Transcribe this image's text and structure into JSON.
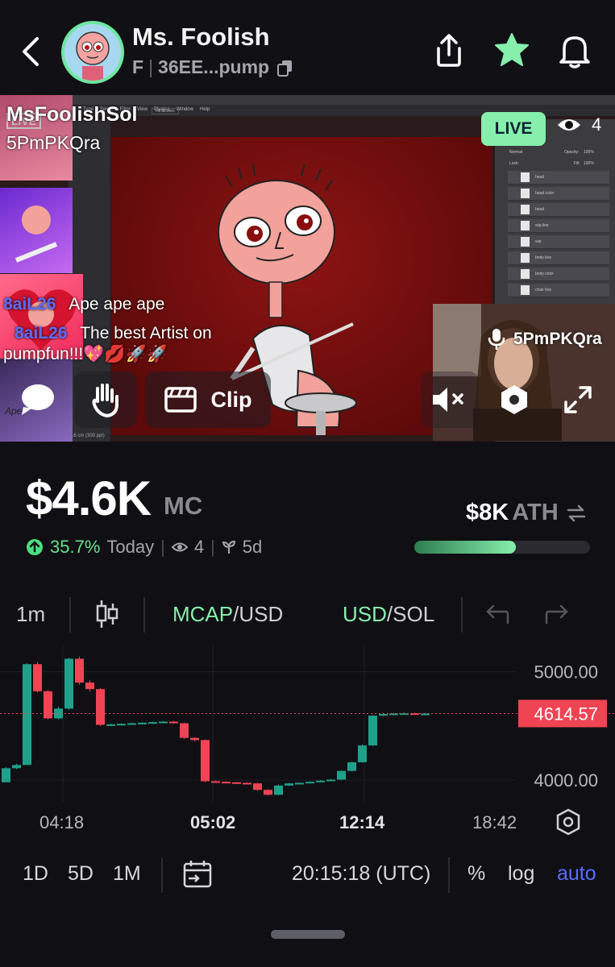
{
  "header": {
    "title": "Ms. Foolish",
    "ticker": "F",
    "contract": "36EE...pump"
  },
  "stream": {
    "streamer_name": "MsFoolishSol",
    "streamer_address": "5PmPKQra",
    "live_label": "LIVE",
    "viewer_count": "4",
    "chat": [
      {
        "user": "8aiL26",
        "text": "Ape ape ape"
      },
      {
        "user": "8aiL26",
        "text": "The best Artist on"
      },
      {
        "user": "",
        "text": "pumpfun!!!💖💋🚀🚀"
      }
    ],
    "webcam_label": "5PmPKQra",
    "clip_label": "Clip",
    "thumbnail_stamp": "LIVE",
    "thumbnail_tag": "Ape",
    "ps_layers": [
      "head",
      "head color",
      "head",
      "wip line",
      "wip",
      "body line",
      "body color",
      "chair line"
    ],
    "ps_panel": {
      "mode": "Normal",
      "opacity_label": "Opacity:",
      "opacity": "100%",
      "lock_label": "Lock:",
      "fill_label": "Fill:",
      "fill": "100%"
    },
    "ps_menu": [
      "Type",
      "Select",
      "Filter",
      "View",
      "Plugins",
      "Window",
      "Help"
    ],
    "ps_button": "Fill Screen",
    "ps_status": "16 cm (300 ppi)"
  },
  "market": {
    "mc_value": "$4.6K",
    "mc_suffix": "MC",
    "change_pct": "35.7%",
    "change_label": "Today",
    "holders": "4",
    "age": "5d",
    "ath_value": "$8K",
    "ath_label": "ATH",
    "ath_progress": 0.58
  },
  "chart_toolbar": {
    "interval": "1m",
    "mcap_left": "MCAP",
    "mcap_right": "/USD",
    "usd_left": "USD",
    "usd_right": "/SOL"
  },
  "chart_data": {
    "type": "candlestick",
    "y_ticks": [
      "5000.00",
      "4000.00"
    ],
    "current_price": "4614.57",
    "x_ticks": [
      "04:18",
      "05:02",
      "12:14",
      "18:42"
    ],
    "ylim": [
      3800,
      5250
    ],
    "candles": [
      {
        "o": 3980,
        "h": 4120,
        "l": 3980,
        "c": 4110
      },
      {
        "o": 4110,
        "h": 4150,
        "l": 4100,
        "c": 4140
      },
      {
        "o": 4140,
        "h": 5080,
        "l": 4140,
        "c": 5070
      },
      {
        "o": 5070,
        "h": 5090,
        "l": 4810,
        "c": 4820
      },
      {
        "o": 4820,
        "h": 4830,
        "l": 4560,
        "c": 4570
      },
      {
        "o": 4570,
        "h": 4680,
        "l": 4560,
        "c": 4660
      },
      {
        "o": 4660,
        "h": 5130,
        "l": 4650,
        "c": 5120
      },
      {
        "o": 5120,
        "h": 5140,
        "l": 4880,
        "c": 4900
      },
      {
        "o": 4900,
        "h": 4920,
        "l": 4820,
        "c": 4840
      },
      {
        "o": 4840,
        "h": 4850,
        "l": 4500,
        "c": 4510
      },
      {
        "o": 4510,
        "h": 4520,
        "l": 4500,
        "c": 4515
      },
      {
        "o": 4515,
        "h": 4525,
        "l": 4505,
        "c": 4520
      },
      {
        "o": 4520,
        "h": 4530,
        "l": 4510,
        "c": 4525
      },
      {
        "o": 4525,
        "h": 4535,
        "l": 4515,
        "c": 4530
      },
      {
        "o": 4530,
        "h": 4540,
        "l": 4520,
        "c": 4535
      },
      {
        "o": 4535,
        "h": 4545,
        "l": 4525,
        "c": 4540
      },
      {
        "o": 4540,
        "h": 4545,
        "l": 4520,
        "c": 4525
      },
      {
        "o": 4525,
        "h": 4530,
        "l": 4380,
        "c": 4390
      },
      {
        "o": 4390,
        "h": 4395,
        "l": 4360,
        "c": 4370
      },
      {
        "o": 4370,
        "h": 4375,
        "l": 3980,
        "c": 3990
      },
      {
        "o": 3990,
        "h": 3995,
        "l": 3980,
        "c": 3985
      },
      {
        "o": 3985,
        "h": 3990,
        "l": 3975,
        "c": 3980
      },
      {
        "o": 3980,
        "h": 3985,
        "l": 3970,
        "c": 3975
      },
      {
        "o": 3975,
        "h": 3980,
        "l": 3965,
        "c": 3970
      },
      {
        "o": 3970,
        "h": 3975,
        "l": 3900,
        "c": 3910
      },
      {
        "o": 3910,
        "h": 3915,
        "l": 3860,
        "c": 3865
      },
      {
        "o": 3865,
        "h": 3960,
        "l": 3860,
        "c": 3950
      },
      {
        "o": 3950,
        "h": 3975,
        "l": 3945,
        "c": 3970
      },
      {
        "o": 3970,
        "h": 3978,
        "l": 3960,
        "c": 3975
      },
      {
        "o": 3975,
        "h": 3990,
        "l": 3970,
        "c": 3985
      },
      {
        "o": 3985,
        "h": 4000,
        "l": 3980,
        "c": 3995
      },
      {
        "o": 3995,
        "h": 4010,
        "l": 3990,
        "c": 4005
      },
      {
        "o": 4005,
        "h": 4090,
        "l": 4000,
        "c": 4085
      },
      {
        "o": 4085,
        "h": 4170,
        "l": 4080,
        "c": 4165
      },
      {
        "o": 4165,
        "h": 4330,
        "l": 4160,
        "c": 4320
      },
      {
        "o": 4320,
        "h": 4600,
        "l": 4315,
        "c": 4595
      },
      {
        "o": 4595,
        "h": 4615,
        "l": 4590,
        "c": 4610
      },
      {
        "o": 4610,
        "h": 4620,
        "l": 4600,
        "c": 4615
      },
      {
        "o": 4615,
        "h": 4625,
        "l": 4605,
        "c": 4617
      },
      {
        "o": 4617,
        "h": 4622,
        "l": 4608,
        "c": 4612
      },
      {
        "o": 4612,
        "h": 4620,
        "l": 4605,
        "c": 4614
      }
    ],
    "colors": {
      "up": "#1fa08a",
      "down": "#ef4454",
      "price_line": "#ef4454"
    }
  },
  "bottom_bar": {
    "ranges": [
      "1D",
      "5D",
      "1M"
    ],
    "time": "20:15:18 (UTC)",
    "pct": "%",
    "log": "log",
    "auto": "auto"
  },
  "colors": {
    "accent_green": "#86efac",
    "auto_blue": "#5b6cff",
    "background": "#101014"
  }
}
